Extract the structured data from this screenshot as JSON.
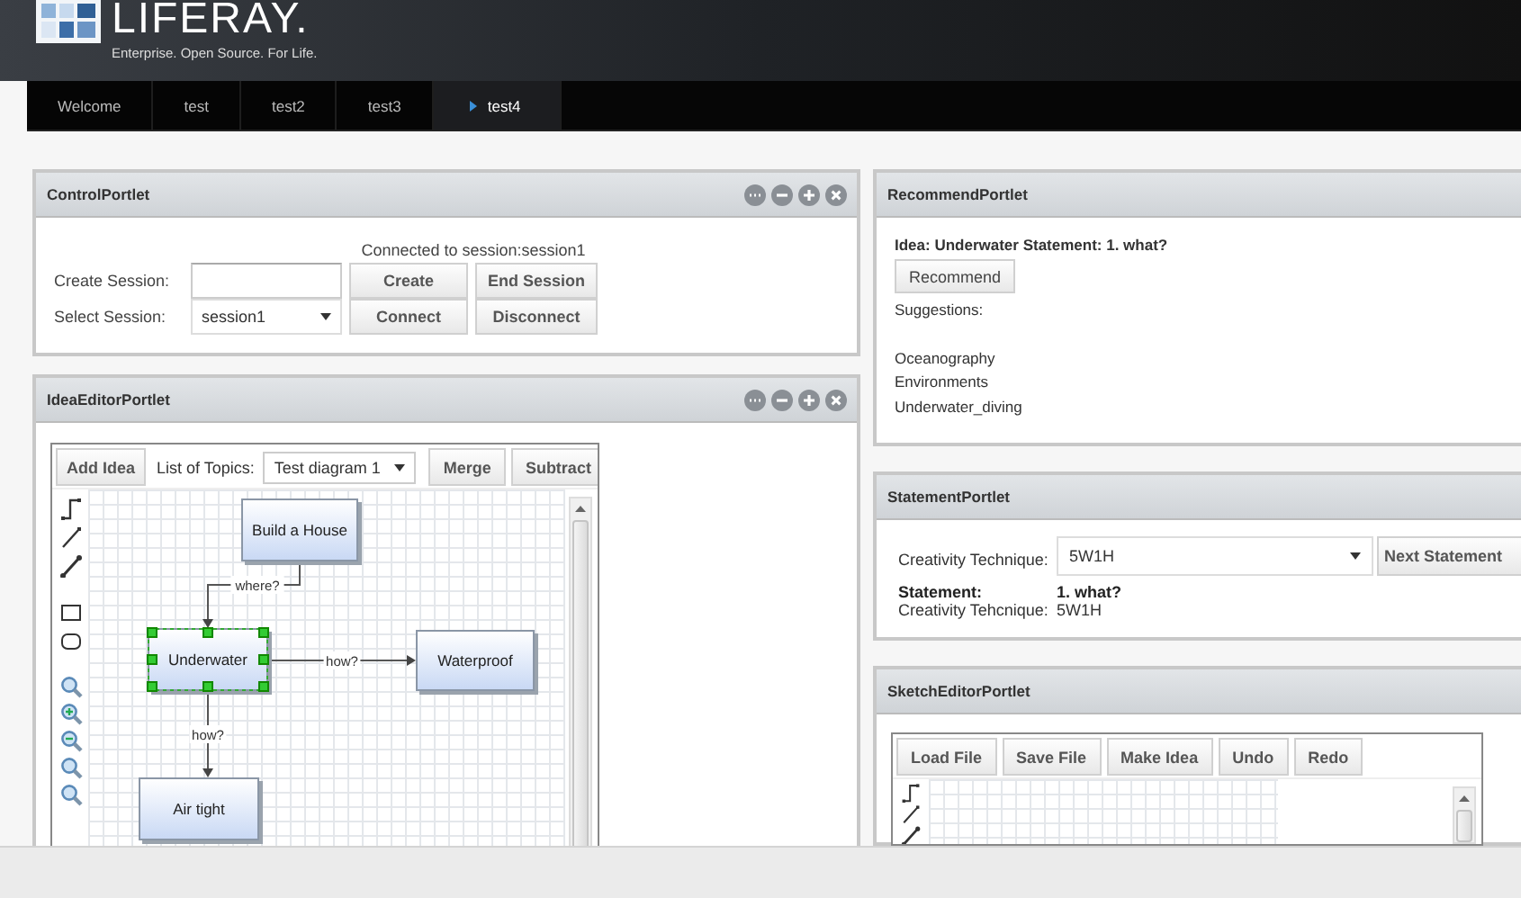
{
  "header": {
    "logo": "LIFERAY.",
    "tagline": "Enterprise. Open Source. For Life."
  },
  "nav": [
    {
      "label": "Welcome",
      "selected": false
    },
    {
      "label": "test",
      "selected": false
    },
    {
      "label": "test2",
      "selected": false
    },
    {
      "label": "test3",
      "selected": false
    },
    {
      "label": "test4",
      "selected": true
    }
  ],
  "control_portlet": {
    "title": "ControlPortlet",
    "window_controls": true,
    "status": "Connected to session:session1",
    "create_label": "Create Session:",
    "select_label": "Select Session:",
    "select_value": "session1",
    "buttons": [
      "Create",
      "End Session",
      "Connect",
      "Disconnect"
    ]
  },
  "idea_editor_portlet": {
    "title": "IdeaEditorPortlet",
    "window_controls": true,
    "add_button": "Add Idea",
    "topics_label": "List of Topics:",
    "topics_value": "Test diagram 1",
    "buttons": [
      "Merge",
      "Subtract"
    ],
    "nodes": [
      {
        "label": "Build a House",
        "selected": false,
        "children": [
          {
            "label": "Underwater",
            "link_label": "where?",
            "selected": true,
            "children": [
              {
                "label": "Waterproof",
                "link_label": "how?",
                "selected": false
              },
              {
                "label": "Air tight",
                "link_label": "how?",
                "selected": false
              }
            ]
          }
        ]
      }
    ]
  },
  "recommend_portlet": {
    "title": "RecommendPortlet",
    "heading": "Idea: Underwater Statement: 1. what?",
    "button": "Recommend",
    "suggestions_label": "Suggestions:",
    "suggestions": [
      "Oceanography",
      "Environments",
      "Underwater_diving"
    ]
  },
  "statement_portlet": {
    "title": "StatementPortlet",
    "technique_label": "Creativity Technique:",
    "technique_value": "5W1H",
    "button": "Next Statement",
    "statement_label": "Statement:",
    "statement_value": "1. what?",
    "current_technique_label": "Creativity Tehcnique:",
    "current_technique_value": "5W1H"
  },
  "sketch_editor_portlet": {
    "title": "SketchEditorPortlet",
    "buttons": [
      "Load File",
      "Save File",
      "Make Idea",
      "Undo",
      "Redo"
    ]
  }
}
